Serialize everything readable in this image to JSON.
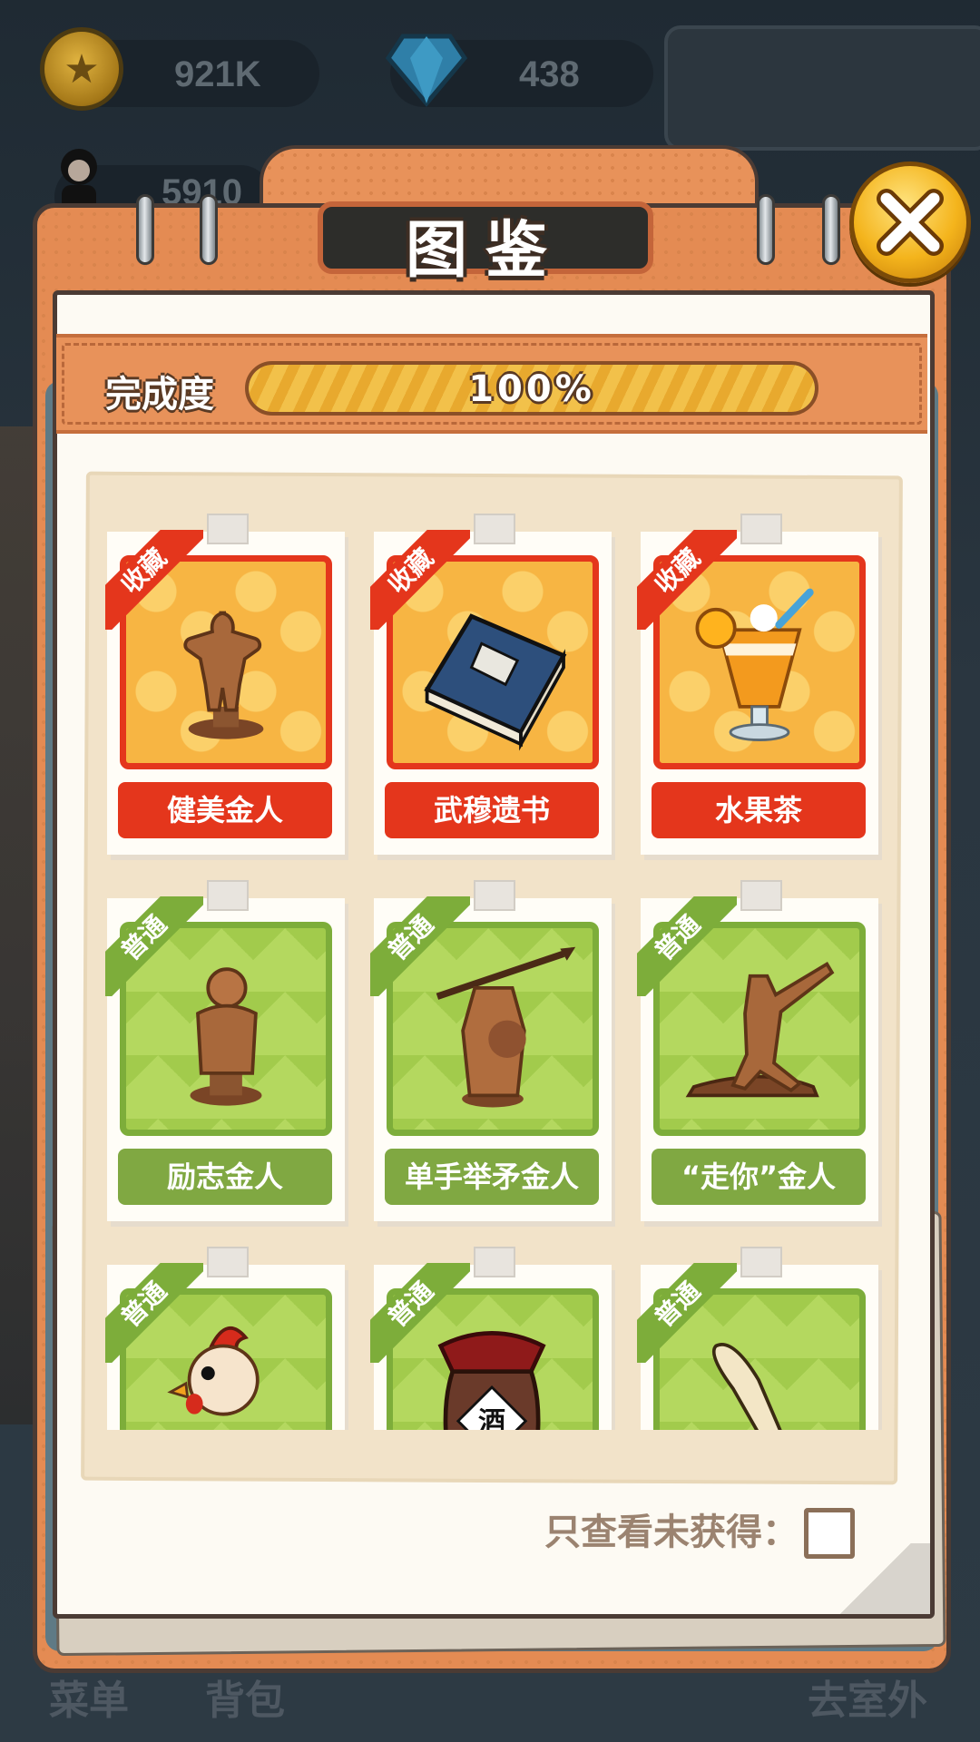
{
  "hud": {
    "coins": "921K",
    "gems": "438",
    "population": "5910"
  },
  "bottom_nav": {
    "menu": "菜单",
    "bag": "背包",
    "go_out": "去室外"
  },
  "modal": {
    "title": "图鉴",
    "progress_label": "完成度",
    "progress_value": "100%",
    "progress_fraction": 1.0,
    "filter_label": "只查看未获得：",
    "filter_checked": false
  },
  "items": [
    {
      "name": "健美金人",
      "rarity": "收藏",
      "tier": "rare",
      "art": "bodybuilder-statue-icon"
    },
    {
      "name": "武穆遗书",
      "rarity": "收藏",
      "tier": "rare",
      "art": "book-icon"
    },
    {
      "name": "水果茶",
      "rarity": "收藏",
      "tier": "rare",
      "art": "fruit-tea-icon"
    },
    {
      "name": "励志金人",
      "rarity": "普通",
      "tier": "common",
      "art": "motivational-statue-icon"
    },
    {
      "name": "单手举矛金人",
      "rarity": "普通",
      "tier": "common",
      "art": "spear-statue-icon"
    },
    {
      "name": "“走你”金人",
      "rarity": "普通",
      "tier": "common",
      "art": "pointing-statue-icon"
    },
    {
      "name": "",
      "rarity": "普通",
      "tier": "common",
      "art": "rooster-icon"
    },
    {
      "name": "",
      "rarity": "普通",
      "tier": "common",
      "art": "wine-jar-icon"
    },
    {
      "name": "",
      "rarity": "普通",
      "tier": "common",
      "art": "knife-icon"
    }
  ],
  "colors": {
    "rare": "#e4361c",
    "common": "#80a842",
    "frame": "#e48b53"
  }
}
